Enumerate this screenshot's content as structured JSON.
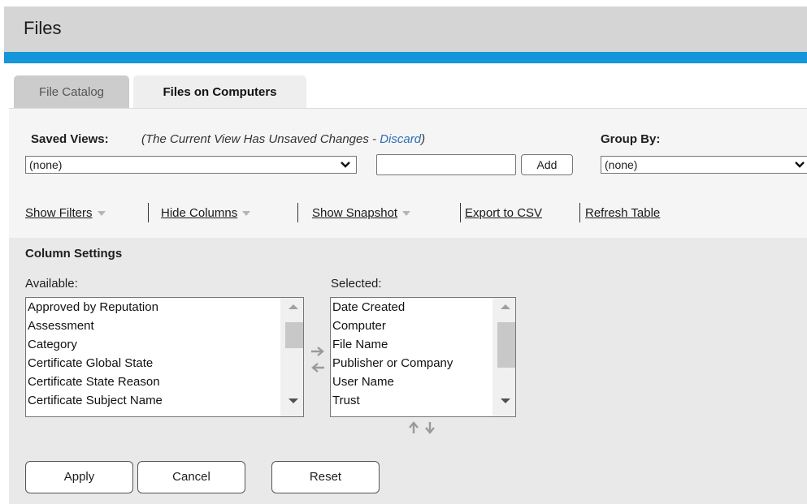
{
  "header": {
    "title": "Files",
    "accent_color": "#1596d8"
  },
  "tabs": [
    {
      "label": "File Catalog",
      "active": false
    },
    {
      "label": "Files on Computers",
      "active": true
    }
  ],
  "saved_views": {
    "label": "Saved Views:",
    "notice_prefix": "(The Current View Has Unsaved Changes - ",
    "discard_label": "Discard",
    "notice_suffix": ")",
    "selected": "(none)",
    "name_value": "",
    "add_label": "Add"
  },
  "group_by": {
    "label": "Group By:",
    "selected": "(none)"
  },
  "toolbar": {
    "show_filters": "Show Filters",
    "hide_columns": "Hide Columns",
    "show_snapshot": "Show Snapshot",
    "export_csv": "Export to CSV",
    "refresh_table": "Refresh Table"
  },
  "column_settings": {
    "title": "Column Settings",
    "available_label": "Available:",
    "selected_label": "Selected:",
    "available": [
      "Approved by Reputation",
      "Assessment",
      "Category",
      "Certificate Global State",
      "Certificate State Reason",
      "Certificate Subject Name"
    ],
    "selected": [
      "Date Created",
      "Computer",
      "File Name",
      "Publisher or Company",
      "User Name",
      "Trust"
    ]
  },
  "buttons": {
    "apply": "Apply",
    "cancel": "Cancel",
    "reset": "Reset"
  },
  "icons": {
    "move_right": "arrow-right-icon",
    "move_left": "arrow-left-icon",
    "move_up": "arrow-up-icon",
    "move_down": "arrow-down-icon"
  }
}
